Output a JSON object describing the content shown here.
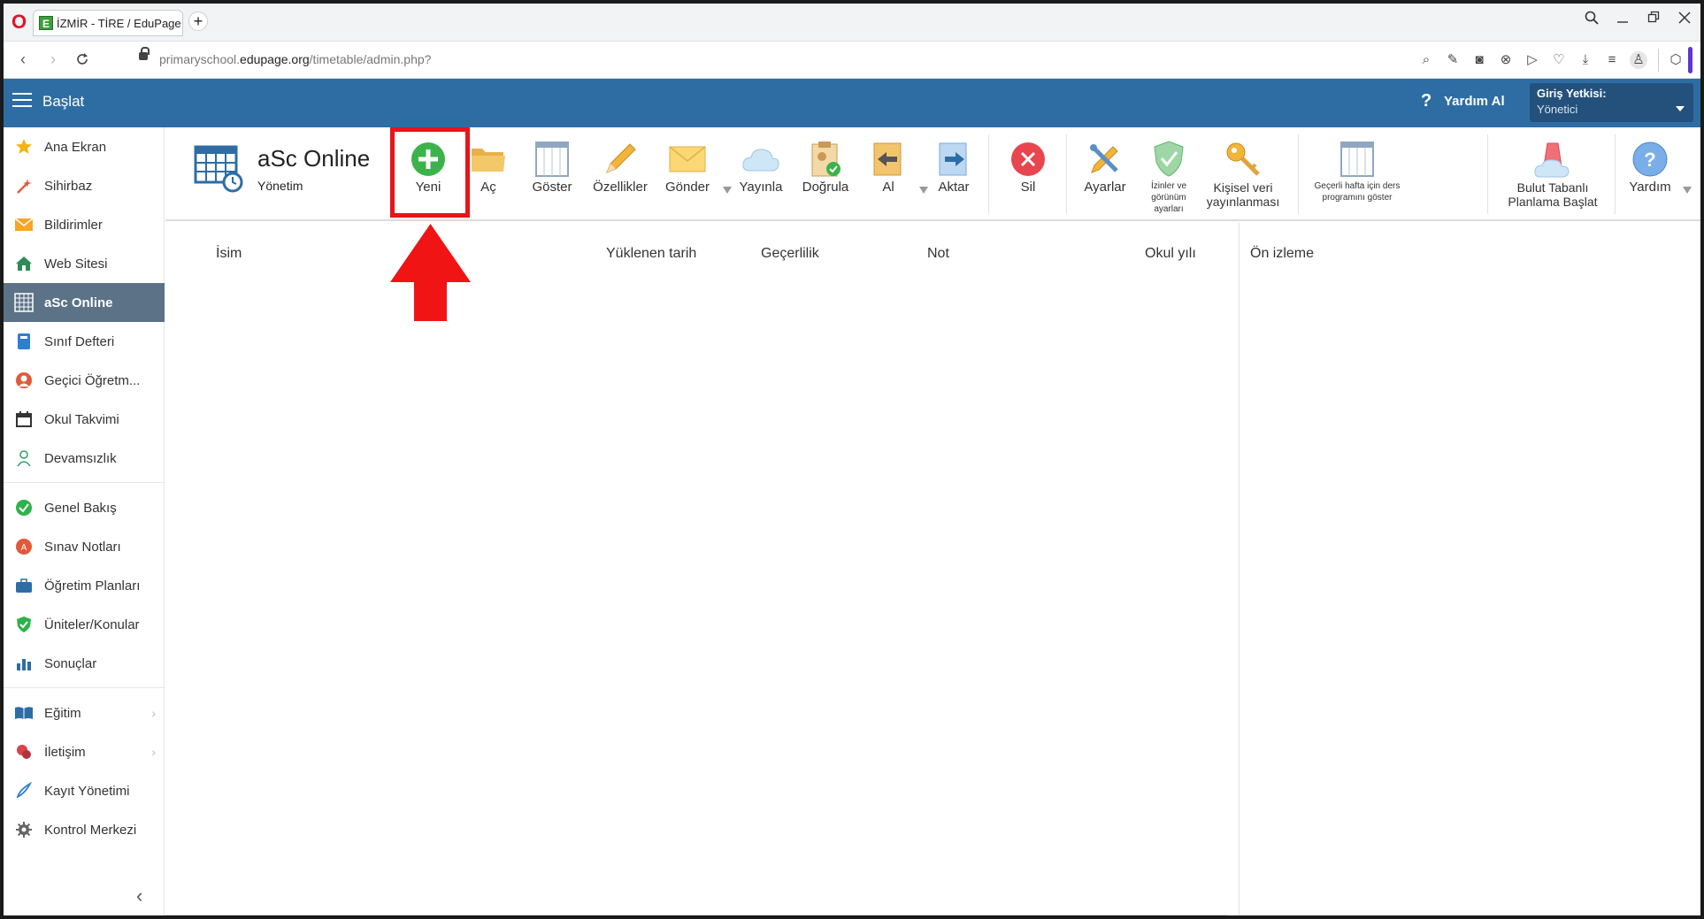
{
  "browser": {
    "tab_title": "İZMİR - TİRE / EduPage D",
    "new_tab": "+",
    "url_prefix": "primaryschool.",
    "url_domain": "edupage.org",
    "url_path": "/timetable/admin.php?"
  },
  "header": {
    "start_label": "Başlat",
    "help_label": "Yardım Al",
    "role_title": "Giriş Yetkisi:",
    "role_value": "Yönetici"
  },
  "sidebar": {
    "items": [
      {
        "label": "Ana Ekran",
        "icon": "star-icon"
      },
      {
        "label": "Sihirbaz",
        "icon": "wizard-icon"
      },
      {
        "label": "Bildirimler",
        "icon": "envelope-icon"
      },
      {
        "label": "Web Sitesi",
        "icon": "house-icon"
      },
      {
        "label": "aSc Online",
        "icon": "grid-icon"
      },
      {
        "label": "Sınıf Defteri",
        "icon": "book-icon"
      },
      {
        "label": "Geçici Öğretm...",
        "icon": "person-icon"
      },
      {
        "label": "Okul Takvimi",
        "icon": "calendar-icon"
      },
      {
        "label": "Devamsızlık",
        "icon": "user-outline-icon"
      },
      {
        "label": "Genel Bakış",
        "icon": "check-circle-icon"
      },
      {
        "label": "Sınav Notları",
        "icon": "grade-icon"
      },
      {
        "label": "Öğretim Planları",
        "icon": "briefcase-icon"
      },
      {
        "label": "Üniteler/Konular",
        "icon": "shield-check-icon"
      },
      {
        "label": "Sonuçlar",
        "icon": "bar-chart-icon"
      },
      {
        "label": "Eğitim",
        "icon": "open-book-icon"
      },
      {
        "label": "İletişim",
        "icon": "chat-icon"
      },
      {
        "label": "Kayıt Yönetimi",
        "icon": "pen-icon"
      },
      {
        "label": "Kontrol Merkezi",
        "icon": "gear-icon"
      }
    ]
  },
  "toolbar": {
    "app_title": "aSc Online",
    "app_subtitle": "Yönetim",
    "buttons": {
      "new": "Yeni",
      "open": "Aç",
      "show": "Göster",
      "properties": "Özellikler",
      "send": "Gönder",
      "publish": "Yayınla",
      "verify": "Doğrula",
      "import": "Al",
      "export": "Aktar",
      "delete": "Sil",
      "settings": "Ayarlar",
      "permissions": "İzinler ve görünüm ayarları",
      "personal_data": "Kişisel veri yayınlanması",
      "valid_week": "Geçerli hafta için ders programını göster",
      "cloud_planning": "Bulut Tabanlı Planlama Başlat",
      "help": "Yardım"
    }
  },
  "table": {
    "columns": [
      "İsim",
      "Yüklenen tarih",
      "Geçerlilik",
      "Not",
      "Okul yılı",
      "Ön izleme"
    ]
  },
  "colors": {
    "header_bg": "#2e6da4",
    "active_item_bg": "#5c7287",
    "highlight": "#e8141a"
  }
}
